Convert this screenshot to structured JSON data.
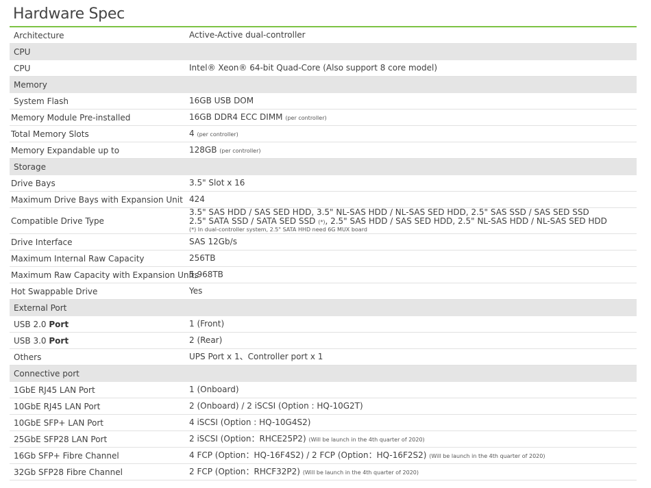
{
  "page": {
    "title": "Hardware Spec"
  },
  "rows": {
    "architecture": {
      "label": "Architecture",
      "value": "Active-Active dual-controller"
    },
    "cpu_section": "CPU",
    "cpu": {
      "label": "CPU",
      "value": "Intel® Xeon®  64-bit Quad-Core (Also support 8 core model)"
    },
    "memory_section": "Memory",
    "system_flash": {
      "label": "System Flash",
      "value": "16GB USB DOM"
    },
    "memory_module": {
      "label": "Memory Module Pre-installed",
      "value": "16GB DDR4 ECC DIMM",
      "note": "(per controller)"
    },
    "total_memory_slots": {
      "label": "Total Memory Slots",
      "value": "4",
      "note": "(per controller)"
    },
    "memory_expandable": {
      "label": "Memory Expandable up to",
      "value": "128GB",
      "note": "(per controller)"
    },
    "storage_section": "Storage",
    "drive_bays": {
      "label": "Drive Bays",
      "value": "3.5\" Slot x 16"
    },
    "max_drive_bays": {
      "label": "Maximum Drive Bays with Expansion Unit",
      "value": "424"
    },
    "compatible_drive": {
      "label": "Compatible Drive Type",
      "line1": "3.5\" SAS HDD / SAS SED HDD, 3.5\" NL-SAS HDD / NL-SAS SED HDD, 2.5\" SAS SSD / SAS SED SSD",
      "line2a": "2.5\" SATA SSD / SATA SED SSD",
      "line2_note": "(*)",
      "line2b": ", 2.5\" SAS HDD / SAS SED HDD, 2.5\" NL-SAS HDD / NL-SAS SED HDD",
      "footnote": "(*) In dual-controller system, 2.5\"  SATA HHD need 6G MUX board"
    },
    "drive_interface": {
      "label": "Drive Interface",
      "value": "SAS 12Gb/s"
    },
    "max_internal_raw": {
      "label": "Maximum Internal Raw Capacity",
      "value": "256TB"
    },
    "max_raw_expansion": {
      "label": "Maximum Raw Capacity with Expansion Units",
      "value": "5,968TB"
    },
    "hot_swappable": {
      "label": "Hot Swappable Drive",
      "value": "Yes"
    },
    "external_port_section": "External Port",
    "usb2": {
      "label": "USB 2.0",
      "label_bold": "Port",
      "value": "1 (Front)"
    },
    "usb3": {
      "label": "USB 3.0",
      "label_bold": "Port",
      "value": "2 (Rear)"
    },
    "others": {
      "label": "Others",
      "value": "UPS Port x 1、Controller port x 1"
    },
    "connective_section": "Connective port",
    "lan_1gbe": {
      "label": "1GbE RJ45 LAN Port",
      "value": "1 (Onboard)"
    },
    "lan_10gbe_rj45": {
      "label": "10GbE RJ45 LAN Port",
      "value": "2 (Onboard) / 2 iSCSI (Option : HQ-10G2T)"
    },
    "lan_10gbe_sfp": {
      "label": "10GbE SFP+ LAN Port",
      "value": "4 iSCSI (Option : HQ-10G4S2)"
    },
    "lan_25gbe": {
      "label": "25GbE SFP28 LAN Port",
      "value": "2 iSCSI (Option：RHCE25P2)",
      "note": "(Will be launch in the 4th quarter of 2020)"
    },
    "fc_16gb": {
      "label": "16Gb SFP+ Fibre Channel",
      "value": "4 FCP (Option：HQ-16F4S2) / 2 FCP (Option：HQ-16F2S2)",
      "note": "(Will be launch in the 4th quarter of 2020)"
    },
    "fc_32gb": {
      "label": "32Gb SFP28 Fibre Channel",
      "value": "2 FCP (Option：RHCF32P2)",
      "note": "(Will be launch in the 4th quarter of 2020)"
    }
  },
  "colors": {
    "accent_rule": "#7cc243",
    "section_bg": "#e5e5e5",
    "row_rule": "#e1e1e1"
  }
}
